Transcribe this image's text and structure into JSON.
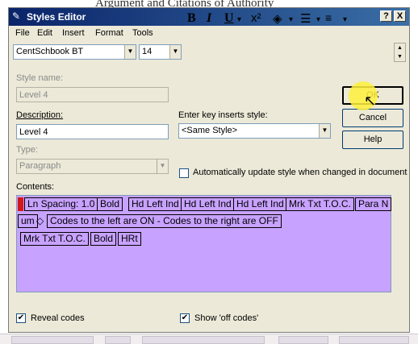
{
  "background": {
    "doc_title": "Argument and Citations of Authority"
  },
  "window": {
    "title": "Styles Editor",
    "help_btn": "?",
    "close_btn": "X"
  },
  "menu": [
    "File",
    "Edit",
    "Insert",
    "Format",
    "Tools"
  ],
  "toolbar": {
    "font": "CentSchbook BT",
    "size": "14",
    "bold": "B",
    "italic": "I",
    "underline": "U",
    "superscript": "x²"
  },
  "form": {
    "style_name_label": "Style name:",
    "style_name_value": "Level 4",
    "description_label": "Description:",
    "description_value": "Level 4",
    "enter_key_label": "Enter key inserts style:",
    "enter_key_value": "<Same Style>",
    "type_label": "Type:",
    "type_value": "Paragraph",
    "auto_update_label": "Automatically update style when changed in document",
    "contents_label": "Contents:"
  },
  "buttons": {
    "ok": "OK",
    "cancel": "Cancel",
    "help": "Help"
  },
  "codes": {
    "row1": [
      "Ln Spacing: 1.0",
      "Bold",
      "Hd Left Ind",
      "Hd Left Ind",
      "Hd Left Ind",
      "Mrk Txt T.O.C.",
      "Para N"
    ],
    "row2_start": "um",
    "row2_divider": "Codes to the left are ON - Codes to the right are OFF",
    "row3": [
      "Mrk Txt T.O.C.",
      "Bold",
      "HRt"
    ]
  },
  "footer": {
    "reveal_codes": "Reveal codes",
    "show_off_codes": "Show 'off codes'"
  }
}
